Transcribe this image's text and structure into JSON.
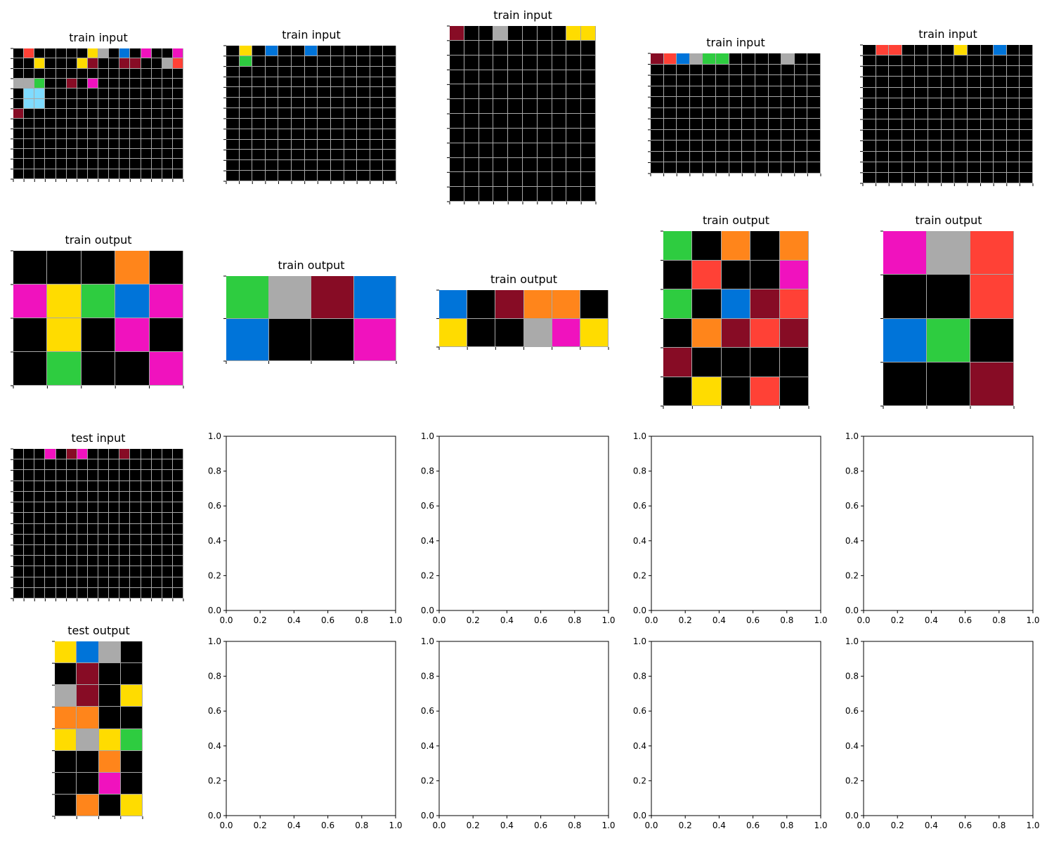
{
  "palette": {
    "0": "#000000",
    "1": "#0074d9",
    "2": "#ff4136",
    "3": "#2ecc40",
    "4": "#ffdc00",
    "5": "#aaaaaa",
    "6": "#f012be",
    "7": "#ff851b",
    "8": "#7fdbff",
    "9": "#870c25"
  },
  "tick_labels": [
    "0.0",
    "0.2",
    "0.4",
    "0.6",
    "0.8",
    "1.0"
  ],
  "panels": [
    {
      "id": "train-input-1",
      "title": "train input",
      "rows": [
        "0200000450106006",
        "0040004900990052",
        "0000000000000000",
        "5530090600000000",
        "0880000000000000",
        "0880000000000000",
        "9000000000000000",
        "0000000000000000",
        "0000000000000000",
        "0000000000000000",
        "0000000000000000",
        "0000000000000000",
        "0000000000000000"
      ]
    },
    {
      "id": "train-input-2",
      "title": "train input",
      "rows": [
        "0401001000000",
        "0300000000000",
        "0000000000000",
        "0000000000000",
        "0000000000000",
        "0000000000000",
        "0000000000000",
        "0000000000000",
        "0000000000000",
        "0000000000000",
        "0000000000000",
        "0000000000000",
        "0000000000000"
      ]
    },
    {
      "id": "train-input-3",
      "title": "train input",
      "rows": [
        "9005000044",
        "0000000000",
        "0000000000",
        "0000000000",
        "0000000000",
        "0000000000",
        "0000000000",
        "0000000000",
        "0000000000",
        "0000000000",
        "0000000000",
        "0000000000"
      ]
    },
    {
      "id": "train-input-4",
      "title": "train input",
      "rows": [
        "9215330000500",
        "0000000000000",
        "0000000000000",
        "0000000000000",
        "0000000000000",
        "0000000000000",
        "0000000000000",
        "0000000000000",
        "0000000000000",
        "0000000000000",
        "0000000000000"
      ]
    },
    {
      "id": "train-input-5",
      "title": "train input",
      "rows": [
        "0220000400100",
        "0000000000000",
        "0000000000000",
        "0000000000000",
        "0000000000000",
        "0000000000000",
        "0000000000000",
        "0000000000000",
        "0000000000000",
        "0000000000000",
        "0000000000000",
        "0000000000000",
        "0000000000000"
      ]
    },
    {
      "id": "train-output-1",
      "title": "train output",
      "rows": [
        "00070",
        "64316",
        "04060",
        "03006"
      ]
    },
    {
      "id": "train-output-2",
      "title": "train output",
      "rows": [
        "3591",
        "1006"
      ]
    },
    {
      "id": "train-output-3",
      "title": "train output",
      "rows": [
        "109770",
        "400564"
      ]
    },
    {
      "id": "train-output-4",
      "title": "train output",
      "rows": [
        "30707",
        "02006",
        "30192",
        "07929",
        "90000",
        "04020"
      ]
    },
    {
      "id": "train-output-5",
      "title": "train output",
      "rows": [
        "652",
        "002",
        "130",
        "009"
      ]
    },
    {
      "id": "test-input-1",
      "title": "test input",
      "rows": [
        "0006096000900000",
        "0000000000000000",
        "0000000000000000",
        "0000000000000000",
        "0000000000000000",
        "0000000000000000",
        "0000000000000000",
        "0000000000000000",
        "0000000000000000",
        "0000000000000000",
        "0000000000000000",
        "0000000000000000",
        "0000000000000000",
        "0000000000000000"
      ]
    },
    {
      "id": "test-output-1",
      "title": "test output",
      "rows": [
        "4150",
        "0900",
        "5904",
        "7700",
        "4543",
        "0070",
        "0060",
        "0704"
      ]
    }
  ]
}
